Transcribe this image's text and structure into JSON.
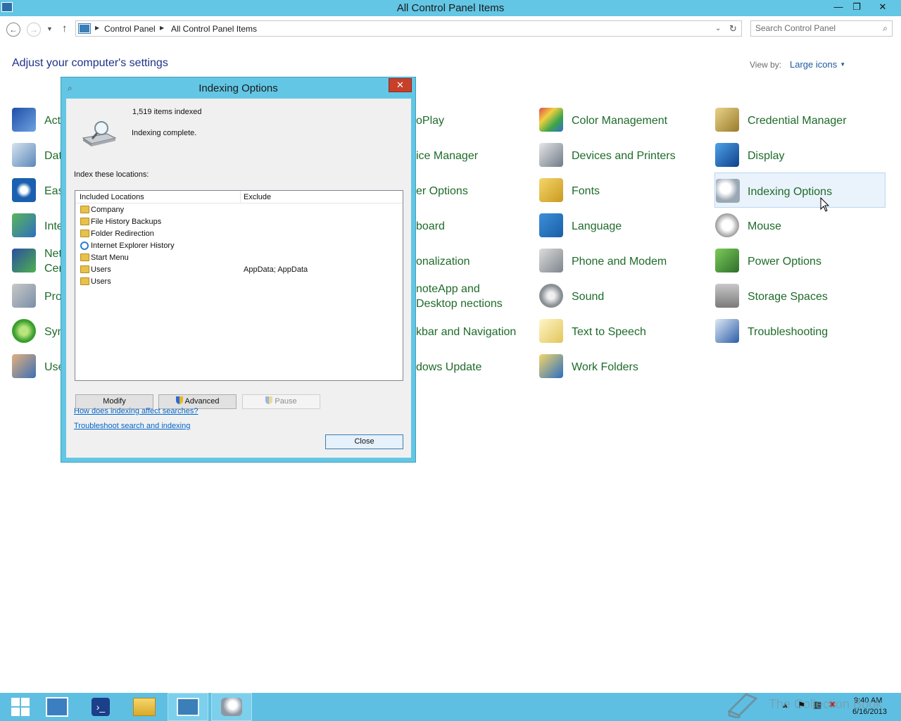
{
  "window": {
    "title": "All Control Panel Items",
    "min_glyph": "—",
    "max_glyph": "❐",
    "close_glyph": "✕"
  },
  "address": {
    "crumbs": [
      "Control Panel",
      "All Control Panel Items"
    ],
    "search_placeholder": "Search Control Panel"
  },
  "header": {
    "title": "Adjust your computer's settings",
    "view_by_label": "View by:",
    "view_by_value": "Large icons"
  },
  "items": {
    "col1": [
      "Acti",
      "Dat",
      "Eas",
      "Inte",
      "Net Cen",
      "Pro",
      "Syn",
      "Use"
    ],
    "col2": [
      "oPlay",
      "ice Manager",
      "er Options",
      "board",
      "onalization",
      "noteApp and Desktop nections",
      "kbar and Navigation",
      "dows Update"
    ],
    "col3": [
      "Color Management",
      "Devices and Printers",
      "Fonts",
      "Language",
      "Phone and Modem",
      "Sound",
      "Text to Speech",
      "Work Folders"
    ],
    "col4": [
      "Credential Manager",
      "Display",
      "Indexing Options",
      "Mouse",
      "Power Options",
      "Storage Spaces",
      "Troubleshooting"
    ]
  },
  "dialog": {
    "title": "Indexing Options",
    "items_indexed": "1,519 items indexed",
    "status": "Indexing complete.",
    "locations_label": "Index these locations:",
    "columns": [
      "Included Locations",
      "Exclude"
    ],
    "rows": [
      {
        "location": "Company",
        "exclude": "",
        "icon": "folder-icon"
      },
      {
        "location": "File History Backups",
        "exclude": "",
        "icon": "folder-icon"
      },
      {
        "location": "Folder Redirection",
        "exclude": "",
        "icon": "folder-icon"
      },
      {
        "location": "Internet Explorer History",
        "exclude": "",
        "icon": "ie-icon"
      },
      {
        "location": "Start Menu",
        "exclude": "",
        "icon": "folder-icon"
      },
      {
        "location": "Users",
        "exclude": "AppData; AppData",
        "icon": "folder-icon"
      },
      {
        "location": "Users",
        "exclude": "",
        "icon": "folder-icon"
      }
    ],
    "buttons": {
      "modify": "Modify",
      "advanced": "Advanced",
      "pause": "Pause",
      "close": "Close"
    },
    "links": {
      "how": "How does indexing affect searches?",
      "troubleshoot": "Troubleshoot search and indexing"
    }
  },
  "taskbar": {
    "time": "9:40 AM",
    "date": "6/16/2013",
    "watermark": "The Collection Book"
  },
  "colors": {
    "accent": "#63c6e5",
    "link_green": "#1e6b2a",
    "heading_blue": "#1e3287",
    "taskbar": "#5ebfe2"
  }
}
